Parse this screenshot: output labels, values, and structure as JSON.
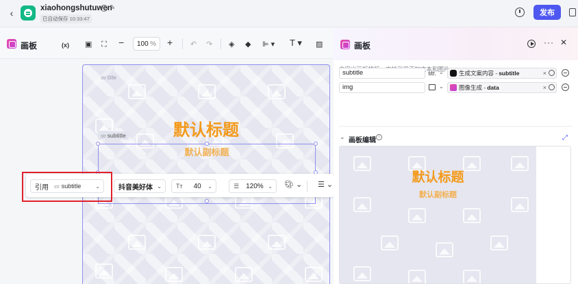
{
  "header": {
    "app_name": "xiaohongshutuwen",
    "autosave": "已自动保存 10:33:47",
    "publish_label": "发布"
  },
  "editor": {
    "title": "画板",
    "var_icon": "(x)",
    "zoom_value": "100",
    "zoom_unit": "%",
    "text_tool": "T"
  },
  "canvas": {
    "title_tag": "title",
    "subtitle_tag": "subtitle",
    "title_text": "默认标题",
    "subtitle_text": "默认副标题"
  },
  "format_bar": {
    "ref_label": "引用",
    "ref_value": "subtitle",
    "font": "抖音美好体",
    "font_size": "40",
    "line_height": "120%"
  },
  "right_panel": {
    "title": "画板",
    "description": "自定义画板排版，支持引用添加文本和图片",
    "rows": [
      {
        "name": "subtitle",
        "type": "str.",
        "source": "生成文案内容 -",
        "key": "subtitle"
      },
      {
        "name": "img",
        "type": "",
        "source": "图像生成 -",
        "key": "data"
      }
    ],
    "section_title": "画板编辑",
    "preview_title": "默认标题",
    "preview_subtitle": "默认副标题"
  },
  "colors": {
    "accent": "#4e57f0",
    "title_orange": "#f39a1c",
    "subtitle_orange": "#f2b155",
    "highlight_red": "#e0202a"
  }
}
